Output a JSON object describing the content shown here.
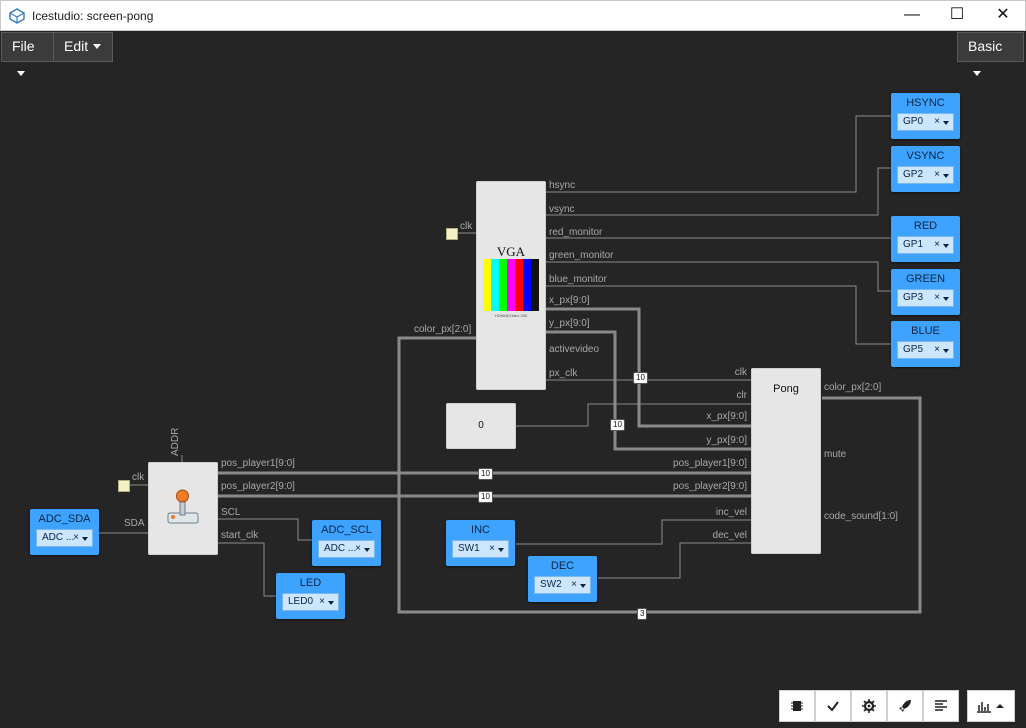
{
  "window": {
    "title": "Icestudio: screen-pong",
    "minimize": "—",
    "maximize": "☐",
    "close": "✕"
  },
  "menu": {
    "file": "File",
    "edit": "Edit",
    "mode": "Basic"
  },
  "vga": {
    "title": "VGA",
    "caption": "HDMI@Video 356",
    "clk": "clk",
    "outputs": [
      "hsync",
      "vsync",
      "red_monitor",
      "green_monitor",
      "blue_monitor",
      "x_px[9:0]",
      "y_px[9:0]",
      "activevideo",
      "px_clk"
    ],
    "input": "color_px[2:0]",
    "colorbars": [
      "#ffff00",
      "#00ffff",
      "#00ff00",
      "#ff00ff",
      "#ff0000",
      "#0000ff",
      "#111111"
    ]
  },
  "pong": {
    "title": "Pong",
    "inputs": [
      "clk",
      "clr",
      "x_px[9:0]",
      "y_px[9:0]",
      "pos_player1[9:0]",
      "pos_player2[9:0]",
      "inc_vel",
      "dec_vel"
    ],
    "outputs": [
      "color_px[2:0]",
      "mute",
      "code_sound[1:0]"
    ]
  },
  "const_block": {
    "value": "0"
  },
  "joystick": {
    "addr": "ADDR",
    "clk": "clk",
    "sda": "SDA",
    "outputs": [
      "pos_player1[9:0]",
      "pos_player2[9:0]",
      "SCL",
      "start_clk"
    ]
  },
  "io_blocks": [
    {
      "name": "HSYNC",
      "pin": "GP0"
    },
    {
      "name": "VSYNC",
      "pin": "GP2"
    },
    {
      "name": "RED",
      "pin": "GP1"
    },
    {
      "name": "GREEN",
      "pin": "GP3"
    },
    {
      "name": "BLUE",
      "pin": "GP5"
    },
    {
      "name": "ADC_SDA",
      "pin": "ADC ..."
    },
    {
      "name": "ADC_SCL",
      "pin": "ADC ..."
    },
    {
      "name": "LED",
      "pin": "LED0"
    },
    {
      "name": "INC",
      "pin": "SW1"
    },
    {
      "name": "DEC",
      "pin": "SW2"
    }
  ],
  "wire_badges": [
    "10",
    "10",
    "10",
    "10",
    "3"
  ],
  "toolbar": [
    "chip-icon",
    "check-icon",
    "gear-icon",
    "rocket-icon",
    "align-left-icon",
    "bar-chart-icon"
  ],
  "colors": {
    "io": "#3ea3ff",
    "block": "#e6e6e6",
    "wire": "#8a8a8a",
    "background": "#252525"
  }
}
